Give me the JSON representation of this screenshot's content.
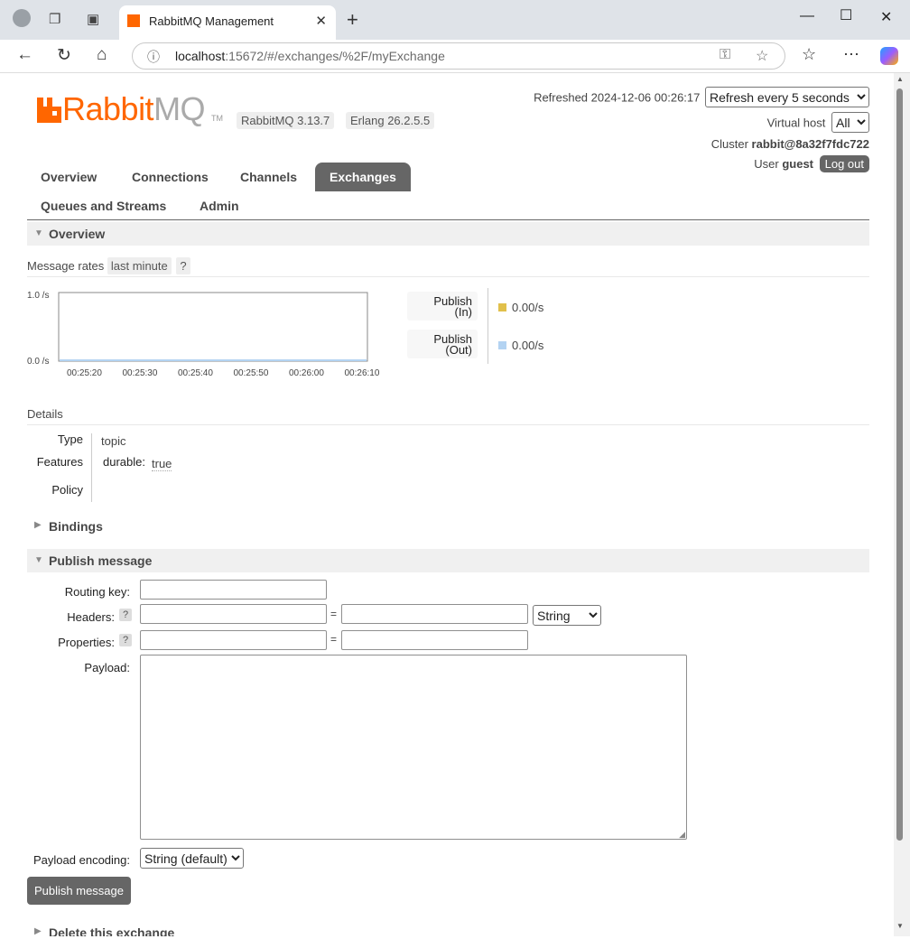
{
  "browser": {
    "tab_title": "RabbitMQ Management",
    "url_host": "localhost",
    "url_rest": ":15672/#/exchanges/%2F/myExchange"
  },
  "header": {
    "logo_part1": "Rabbit",
    "logo_part2": "MQ",
    "logo_tm": "TM",
    "version": "RabbitMQ 3.13.7",
    "erlang": "Erlang 26.2.5.5",
    "refreshed": "Refreshed 2024-12-06 00:26:17",
    "refresh_select": "Refresh every 5 seconds",
    "vhost_label": "Virtual host",
    "vhost_select": "All",
    "cluster_label": "Cluster",
    "cluster_value": "rabbit@8a32f7fdc722",
    "user_label": "User",
    "user_value": "guest",
    "logout": "Log out"
  },
  "nav": {
    "overview": "Overview",
    "connections": "Connections",
    "channels": "Channels",
    "exchanges": "Exchanges",
    "queues": "Queues and Streams",
    "admin": "Admin"
  },
  "overview": {
    "title": "Overview",
    "rates_label": "Message rates",
    "rates_period": "last minute",
    "help": "?"
  },
  "chart_data": {
    "type": "line",
    "x": [
      "00:25:20",
      "00:25:30",
      "00:25:40",
      "00:25:50",
      "00:26:00",
      "00:26:10"
    ],
    "yticks": [
      "1.0 /s",
      "0.0 /s"
    ],
    "ylim": [
      0,
      1
    ],
    "series": [
      {
        "name": "Publish (In)",
        "values": [
          0,
          0,
          0,
          0,
          0,
          0
        ],
        "color": "#e1c04b"
      },
      {
        "name": "Publish (Out)",
        "values": [
          0,
          0,
          0,
          0,
          0,
          0
        ],
        "color": "#b3d3f2"
      }
    ]
  },
  "rates": [
    {
      "label1": "Publish",
      "label2": "(In)",
      "value": "0.00/s",
      "color": "#e1c04b"
    },
    {
      "label1": "Publish",
      "label2": "(Out)",
      "value": "0.00/s",
      "color": "#b3d3f2"
    }
  ],
  "details": {
    "title": "Details",
    "type_label": "Type",
    "type_value": "topic",
    "features_label": "Features",
    "durable_key": "durable:",
    "durable_value": "true",
    "policy_label": "Policy"
  },
  "bindings": {
    "title": "Bindings"
  },
  "publish": {
    "title": "Publish message",
    "routing_key_label": "Routing key:",
    "headers_label": "Headers:",
    "properties_label": "Properties:",
    "payload_label": "Payload:",
    "help": "?",
    "equals": "=",
    "type_select": "String",
    "encoding_label": "Payload encoding:",
    "encoding_select": "String (default)",
    "button": "Publish message"
  },
  "delete": {
    "title": "Delete this exchange"
  }
}
